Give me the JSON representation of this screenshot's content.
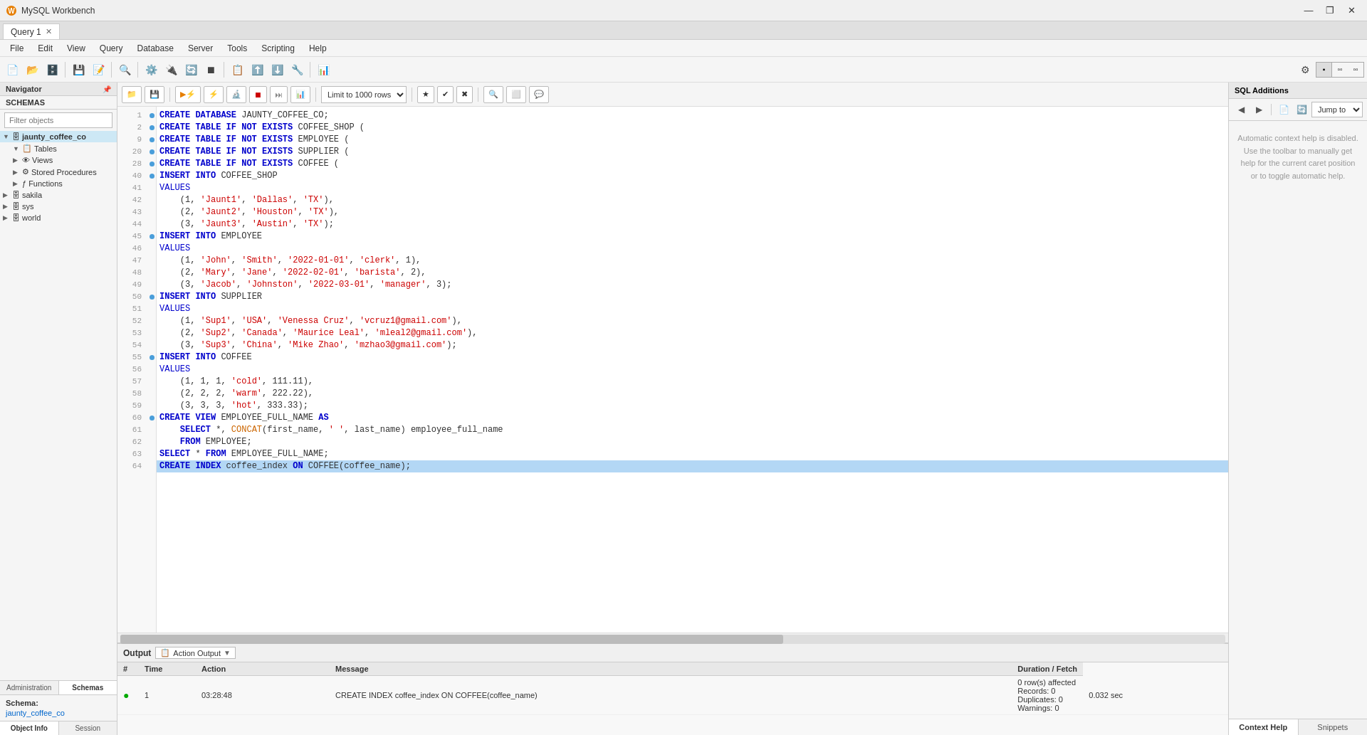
{
  "titleBar": {
    "appName": "MySQL Workbench",
    "winControls": [
      "—",
      "❐",
      "✕"
    ]
  },
  "menuBar": {
    "items": [
      "File",
      "Edit",
      "View",
      "Query",
      "Database",
      "Server",
      "Tools",
      "Scripting",
      "Help"
    ]
  },
  "tabs": [
    {
      "label": "Query 1",
      "active": true
    }
  ],
  "queryToolbar": {
    "limitLabel": "Limit to 1000 rows"
  },
  "sqlAdditions": {
    "header": "SQL Additions",
    "helpText": "Automatic context help is disabled. Use the toolbar to manually get help for the current caret position or to toggle automatic help.",
    "jumpToLabel": "Jump to"
  },
  "rightTabs": [
    {
      "label": "Context Help",
      "active": true
    },
    {
      "label": "Snippets",
      "active": false
    }
  ],
  "navigator": {
    "header": "Navigator",
    "schemasHeader": "SCHEMAS",
    "filterPlaceholder": "Filter objects"
  },
  "schemaTree": {
    "items": [
      {
        "level": 0,
        "icon": "▼",
        "label": "jaunty_coffee_co",
        "bold": true,
        "expanded": true
      },
      {
        "level": 1,
        "icon": "▼",
        "label": "Tables",
        "expanded": true
      },
      {
        "level": 1,
        "icon": "▶",
        "label": "Views",
        "expanded": false
      },
      {
        "level": 1,
        "icon": "▶",
        "label": "Stored Procedures",
        "expanded": false
      },
      {
        "level": 1,
        "icon": "▶",
        "label": "Functions",
        "expanded": false
      },
      {
        "level": 0,
        "icon": "▶",
        "label": "sakila",
        "expanded": false
      },
      {
        "level": 0,
        "icon": "▶",
        "label": "sys",
        "expanded": false
      },
      {
        "level": 0,
        "icon": "▶",
        "label": "world",
        "expanded": false
      }
    ]
  },
  "leftBottomTabs": [
    "Administration",
    "Schemas"
  ],
  "activeLeftTab": 1,
  "schemaInfo": {
    "label": "Schema:",
    "value": "jaunty_coffee_co"
  },
  "objTabs": [
    "Object Info",
    "Session"
  ],
  "activeObjTab": 0,
  "editor": {
    "lines": [
      {
        "num": 1,
        "hasDot": true,
        "code": "<kw>CREATE DATABASE</kw> JAUNTY_COFFEE_CO;",
        "selected": false
      },
      {
        "num": 2,
        "hasDot": true,
        "code": "<kw>CREATE TABLE IF NOT EXISTS</kw> COFFEE_SHOP (",
        "selected": false
      },
      {
        "num": 9,
        "hasDot": true,
        "code": "<kw>CREATE TABLE IF NOT EXISTS</kw> EMPLOYEE (",
        "selected": false
      },
      {
        "num": 20,
        "hasDot": true,
        "code": "<kw>CREATE TABLE IF NOT EXISTS</kw> SUPPLIER (",
        "selected": false
      },
      {
        "num": 28,
        "hasDot": true,
        "code": "<kw>CREATE TABLE IF NOT EXISTS</kw> COFFEE (",
        "selected": false
      },
      {
        "num": 40,
        "hasDot": true,
        "code": "<kw>INSERT INTO</kw> COFFEE_SHOP",
        "selected": false
      },
      {
        "num": 41,
        "hasDot": false,
        "code": "VALUES",
        "selected": false
      },
      {
        "num": 42,
        "hasDot": false,
        "code": "    (1, <str>'Jaunt1'</str>, <str>'Dallas'</str>, <str>'TX'</str>),",
        "selected": false
      },
      {
        "num": 43,
        "hasDot": false,
        "code": "    (2, <str>'Jaunt2'</str>, <str>'Houston'</str>, <str>'TX'</str>),",
        "selected": false
      },
      {
        "num": 44,
        "hasDot": false,
        "code": "    (3, <str>'Jaunt3'</str>, <str>'Austin'</str>, <str>'TX'</str>);",
        "selected": false
      },
      {
        "num": 45,
        "hasDot": true,
        "code": "<kw>INSERT INTO</kw> EMPLOYEE",
        "selected": false
      },
      {
        "num": 46,
        "hasDot": false,
        "code": "VALUES",
        "selected": false
      },
      {
        "num": 47,
        "hasDot": false,
        "code": "    (1, <str>'John'</str>, <str>'Smith'</str>, <str>'2022-01-01'</str>, <str>'clerk'</str>, 1),",
        "selected": false
      },
      {
        "num": 48,
        "hasDot": false,
        "code": "    (2, <str>'Mary'</str>, <str>'Jane'</str>, <str>'2022-02-01'</str>, <str>'barista'</str>, 2),",
        "selected": false
      },
      {
        "num": 49,
        "hasDot": false,
        "code": "    (3, <str>'Jacob'</str>, <str>'Johnston'</str>, <str>'2022-03-01'</str>, <str>'manager'</str>, 3);",
        "selected": false
      },
      {
        "num": 50,
        "hasDot": true,
        "code": "<kw>INSERT INTO</kw> SUPPLIER",
        "selected": false
      },
      {
        "num": 51,
        "hasDot": false,
        "code": "VALUES",
        "selected": false
      },
      {
        "num": 52,
        "hasDot": false,
        "code": "    (1, <str>'Sup1'</str>, <str>'USA'</str>, <str>'Venessa Cruz'</str>, <str>'vcruz1@gmail.com'</str>),",
        "selected": false
      },
      {
        "num": 53,
        "hasDot": false,
        "code": "    (2, <str>'Sup2'</str>, <str>'Canada'</str>, <str>'Maurice Leal'</str>, <str>'mleal2@gmail.com'</str>),",
        "selected": false
      },
      {
        "num": 54,
        "hasDot": false,
        "code": "    (3, <str>'Sup3'</str>, <str>'China'</str>, <str>'Mike Zhao'</str>, <str>'mzhao3@gmail.com'</str>);",
        "selected": false
      },
      {
        "num": 55,
        "hasDot": true,
        "code": "<kw>INSERT INTO</kw> COFFEE",
        "selected": false
      },
      {
        "num": 56,
        "hasDot": false,
        "code": "VALUES",
        "selected": false
      },
      {
        "num": 57,
        "hasDot": false,
        "code": "    (1, 1, 1, <str>'cold'</str>, 111.11),",
        "selected": false
      },
      {
        "num": 58,
        "hasDot": false,
        "code": "    (2, 2, 2, <str>'warm'</str>, 222.22),",
        "selected": false
      },
      {
        "num": 59,
        "hasDot": false,
        "code": "    (3, 3, 3, <str>'hot'</str>, 333.33);",
        "selected": false
      },
      {
        "num": 60,
        "hasDot": true,
        "code": "<kw>CREATE VIEW</kw> EMPLOYEE_FULL_NAME <kw>AS</kw>",
        "selected": false
      },
      {
        "num": 61,
        "hasDot": false,
        "code": "    <kw>SELECT</kw> *, <fn>CONCAT</fn>(first_name, <str>' '</str>, last_name) employee_full_name",
        "selected": false
      },
      {
        "num": 62,
        "hasDot": false,
        "code": "    <kw>FROM</kw> EMPLOYEE;",
        "selected": false
      },
      {
        "num": 63,
        "hasDot": false,
        "code": "<kw>SELECT</kw> * <kw>FROM</kw> EMPLOYEE_FULL_NAME;",
        "selected": false
      },
      {
        "num": 64,
        "hasDot": false,
        "code": "<kw>CREATE INDEX</kw> coffee_index <kw>ON</kw> COFFEE(coffee_name);",
        "selected": true
      }
    ]
  },
  "output": {
    "header": "Output",
    "actionOutputLabel": "Action Output",
    "tableHeaders": [
      "#",
      "Time",
      "Action",
      "Message",
      "Duration / Fetch"
    ],
    "rows": [
      {
        "status": "ok",
        "num": "1",
        "time": "03:28:48",
        "action": "CREATE INDEX coffee_index ON COFFEE(coffee_name)",
        "message": "0 row(s) affected Records: 0  Duplicates: 0  Warnings: 0",
        "duration": "0.032 sec"
      }
    ]
  }
}
